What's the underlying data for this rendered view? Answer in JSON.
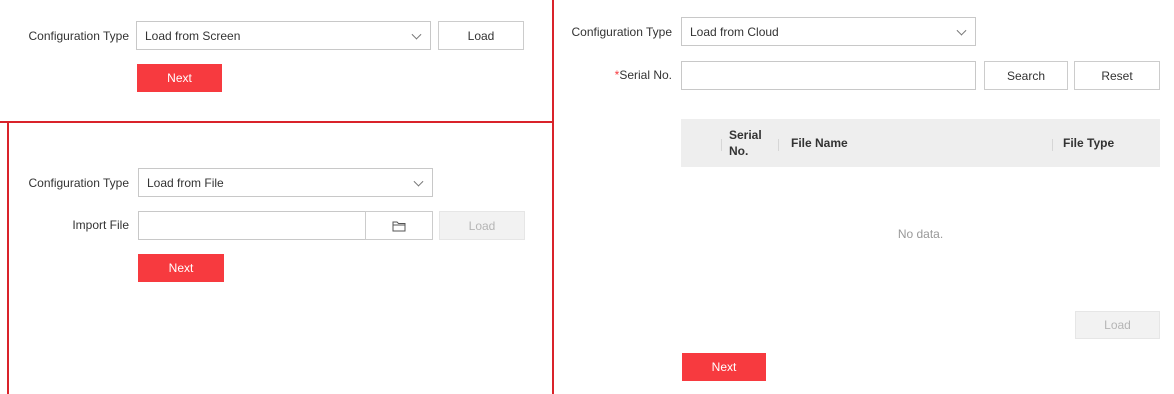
{
  "panel_screen": {
    "config_type_label": "Configuration Type",
    "config_type_value": "Load from Screen",
    "load_label": "Load",
    "next_label": "Next"
  },
  "panel_file": {
    "config_type_label": "Configuration Type",
    "config_type_value": "Load from File",
    "import_file_label": "Import File",
    "import_file_value": "",
    "load_label": "Load",
    "next_label": "Next"
  },
  "panel_cloud": {
    "config_type_label": "Configuration Type",
    "config_type_value": "Load from Cloud",
    "required_mark": "*",
    "serial_label": "Serial No.",
    "serial_value": "",
    "search_label": "Search",
    "reset_label": "Reset",
    "table": {
      "columns": [
        "Serial No.",
        "File Name",
        "File Type"
      ],
      "empty_text": "No data."
    },
    "load_label": "Load",
    "next_label": "Next"
  },
  "colors": {
    "accent": "#f73a3f",
    "divider": "#d9232a",
    "table_header_bg": "#eeeeee"
  },
  "icons": {
    "dropdown": "chevron-down-icon",
    "browse": "folder-icon"
  }
}
